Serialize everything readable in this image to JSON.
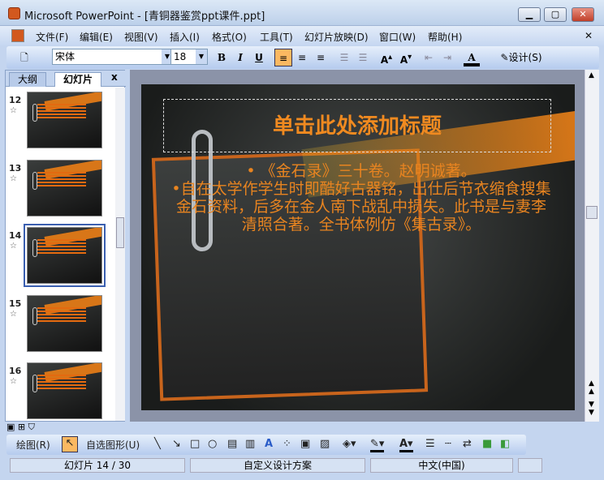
{
  "window": {
    "title": "Microsoft PowerPoint - [青铜器鉴赏ppt课件.ppt]"
  },
  "menu": [
    "文件(F)",
    "编辑(E)",
    "视图(V)",
    "插入(I)",
    "格式(O)",
    "工具(T)",
    "幻灯片放映(D)",
    "窗口(W)",
    "帮助(H)"
  ],
  "toolbar": {
    "font": "宋体",
    "size": "18",
    "bold": "B",
    "italic": "I",
    "underline": "U",
    "font_color": "A",
    "design": "设计(S)"
  },
  "pane": {
    "tabs": [
      "大纲",
      "幻灯片"
    ],
    "close": "x",
    "slides": [
      {
        "num": "12"
      },
      {
        "num": "13"
      },
      {
        "num": "14",
        "selected": true
      },
      {
        "num": "15"
      },
      {
        "num": "16"
      }
    ]
  },
  "slide": {
    "title": "单击此处添加标题",
    "bullets": [
      "《金石录》三十卷。赵明诚著。",
      "自在太学作学生时即酷好古器铭，出仕后节衣缩食搜集金石资料，后多在金人南下战乱中损失。此书是与妻李清照合著。全书体例仿《集古录》。"
    ]
  },
  "drawbar": {
    "draw": "绘图(R)",
    "autoshapes": "自选图形(U)"
  },
  "status": {
    "slide": "幻灯片 14 / 30",
    "design": "自定义设计方案",
    "lang": "中文(中国)"
  },
  "colors": {
    "accent": "#f08a20"
  }
}
